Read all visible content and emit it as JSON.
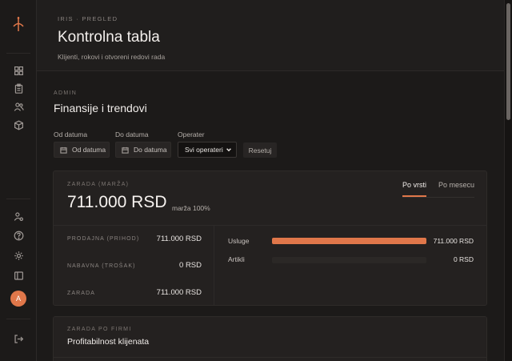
{
  "sidebar": {
    "logo_icon": "compass-logo-icon",
    "nav_icons": [
      "grid-icon",
      "clipboard-icon",
      "users-icon",
      "cube-icon"
    ],
    "bottom_icons": [
      "user-settings-icon",
      "help-icon",
      "gear-icon",
      "sidebar-toggle-icon"
    ],
    "avatar_initial": "A",
    "logout_icon": "logout-icon"
  },
  "header": {
    "eyebrow": "IRIS · PREGLED",
    "title": "Kontrolna tabla",
    "subtitle": "Klijenti, rokovi i otvoreni redovi rada"
  },
  "section": {
    "eyebrow": "ADMIN",
    "title": "Finansije i trendovi"
  },
  "filters": {
    "from_label": "Od datuma",
    "from_placeholder": "Od datuma",
    "to_label": "Do datuma",
    "to_placeholder": "Do datuma",
    "operator_label": "Operater",
    "operator_value": "Svi operateri",
    "reset_label": "Resetuj"
  },
  "earnings_card": {
    "eyebrow": "ZARADA (MARŽA)",
    "amount": "711.000 RSD",
    "margin": "marža 100%",
    "tabs": [
      {
        "label": "Po vrsti",
        "active": true
      },
      {
        "label": "Po mesecu",
        "active": false
      }
    ],
    "metrics": [
      {
        "label": "PRODAJNA (PRIHOD)",
        "value": "711.000 RSD"
      },
      {
        "label": "NABAVNA (TROŠAK)",
        "value": "0 RSD"
      },
      {
        "label": "ZARADA",
        "value": "711.000 RSD"
      }
    ],
    "breakdown": [
      {
        "label": "Usluge",
        "value": "711.000 RSD",
        "fraction": 1.0
      },
      {
        "label": "Artikli",
        "value": "0 RSD",
        "fraction": 0.0
      }
    ],
    "accent_color": "#e0774a"
  },
  "client_card": {
    "eyebrow": "ZARADA PO FIRMI",
    "title": "Profitabilnost klijenata"
  }
}
